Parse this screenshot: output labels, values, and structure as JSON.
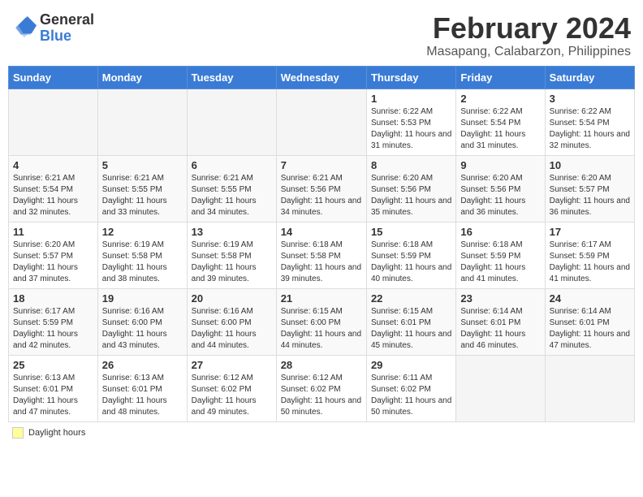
{
  "header": {
    "logo_general": "General",
    "logo_blue": "Blue",
    "month_title": "February 2024",
    "location": "Masapang, Calabarzon, Philippines"
  },
  "weekdays": [
    "Sunday",
    "Monday",
    "Tuesday",
    "Wednesday",
    "Thursday",
    "Friday",
    "Saturday"
  ],
  "legend_label": "Daylight hours",
  "weeks": [
    [
      {
        "day": "",
        "info": ""
      },
      {
        "day": "",
        "info": ""
      },
      {
        "day": "",
        "info": ""
      },
      {
        "day": "",
        "info": ""
      },
      {
        "day": "1",
        "info": "Sunrise: 6:22 AM\nSunset: 5:53 PM\nDaylight: 11 hours and 31 minutes."
      },
      {
        "day": "2",
        "info": "Sunrise: 6:22 AM\nSunset: 5:54 PM\nDaylight: 11 hours and 31 minutes."
      },
      {
        "day": "3",
        "info": "Sunrise: 6:22 AM\nSunset: 5:54 PM\nDaylight: 11 hours and 32 minutes."
      }
    ],
    [
      {
        "day": "4",
        "info": "Sunrise: 6:21 AM\nSunset: 5:54 PM\nDaylight: 11 hours and 32 minutes."
      },
      {
        "day": "5",
        "info": "Sunrise: 6:21 AM\nSunset: 5:55 PM\nDaylight: 11 hours and 33 minutes."
      },
      {
        "day": "6",
        "info": "Sunrise: 6:21 AM\nSunset: 5:55 PM\nDaylight: 11 hours and 34 minutes."
      },
      {
        "day": "7",
        "info": "Sunrise: 6:21 AM\nSunset: 5:56 PM\nDaylight: 11 hours and 34 minutes."
      },
      {
        "day": "8",
        "info": "Sunrise: 6:20 AM\nSunset: 5:56 PM\nDaylight: 11 hours and 35 minutes."
      },
      {
        "day": "9",
        "info": "Sunrise: 6:20 AM\nSunset: 5:56 PM\nDaylight: 11 hours and 36 minutes."
      },
      {
        "day": "10",
        "info": "Sunrise: 6:20 AM\nSunset: 5:57 PM\nDaylight: 11 hours and 36 minutes."
      }
    ],
    [
      {
        "day": "11",
        "info": "Sunrise: 6:20 AM\nSunset: 5:57 PM\nDaylight: 11 hours and 37 minutes."
      },
      {
        "day": "12",
        "info": "Sunrise: 6:19 AM\nSunset: 5:58 PM\nDaylight: 11 hours and 38 minutes."
      },
      {
        "day": "13",
        "info": "Sunrise: 6:19 AM\nSunset: 5:58 PM\nDaylight: 11 hours and 39 minutes."
      },
      {
        "day": "14",
        "info": "Sunrise: 6:18 AM\nSunset: 5:58 PM\nDaylight: 11 hours and 39 minutes."
      },
      {
        "day": "15",
        "info": "Sunrise: 6:18 AM\nSunset: 5:59 PM\nDaylight: 11 hours and 40 minutes."
      },
      {
        "day": "16",
        "info": "Sunrise: 6:18 AM\nSunset: 5:59 PM\nDaylight: 11 hours and 41 minutes."
      },
      {
        "day": "17",
        "info": "Sunrise: 6:17 AM\nSunset: 5:59 PM\nDaylight: 11 hours and 41 minutes."
      }
    ],
    [
      {
        "day": "18",
        "info": "Sunrise: 6:17 AM\nSunset: 5:59 PM\nDaylight: 11 hours and 42 minutes."
      },
      {
        "day": "19",
        "info": "Sunrise: 6:16 AM\nSunset: 6:00 PM\nDaylight: 11 hours and 43 minutes."
      },
      {
        "day": "20",
        "info": "Sunrise: 6:16 AM\nSunset: 6:00 PM\nDaylight: 11 hours and 44 minutes."
      },
      {
        "day": "21",
        "info": "Sunrise: 6:15 AM\nSunset: 6:00 PM\nDaylight: 11 hours and 44 minutes."
      },
      {
        "day": "22",
        "info": "Sunrise: 6:15 AM\nSunset: 6:01 PM\nDaylight: 11 hours and 45 minutes."
      },
      {
        "day": "23",
        "info": "Sunrise: 6:14 AM\nSunset: 6:01 PM\nDaylight: 11 hours and 46 minutes."
      },
      {
        "day": "24",
        "info": "Sunrise: 6:14 AM\nSunset: 6:01 PM\nDaylight: 11 hours and 47 minutes."
      }
    ],
    [
      {
        "day": "25",
        "info": "Sunrise: 6:13 AM\nSunset: 6:01 PM\nDaylight: 11 hours and 47 minutes."
      },
      {
        "day": "26",
        "info": "Sunrise: 6:13 AM\nSunset: 6:01 PM\nDaylight: 11 hours and 48 minutes."
      },
      {
        "day": "27",
        "info": "Sunrise: 6:12 AM\nSunset: 6:02 PM\nDaylight: 11 hours and 49 minutes."
      },
      {
        "day": "28",
        "info": "Sunrise: 6:12 AM\nSunset: 6:02 PM\nDaylight: 11 hours and 50 minutes."
      },
      {
        "day": "29",
        "info": "Sunrise: 6:11 AM\nSunset: 6:02 PM\nDaylight: 11 hours and 50 minutes."
      },
      {
        "day": "",
        "info": ""
      },
      {
        "day": "",
        "info": ""
      }
    ]
  ]
}
